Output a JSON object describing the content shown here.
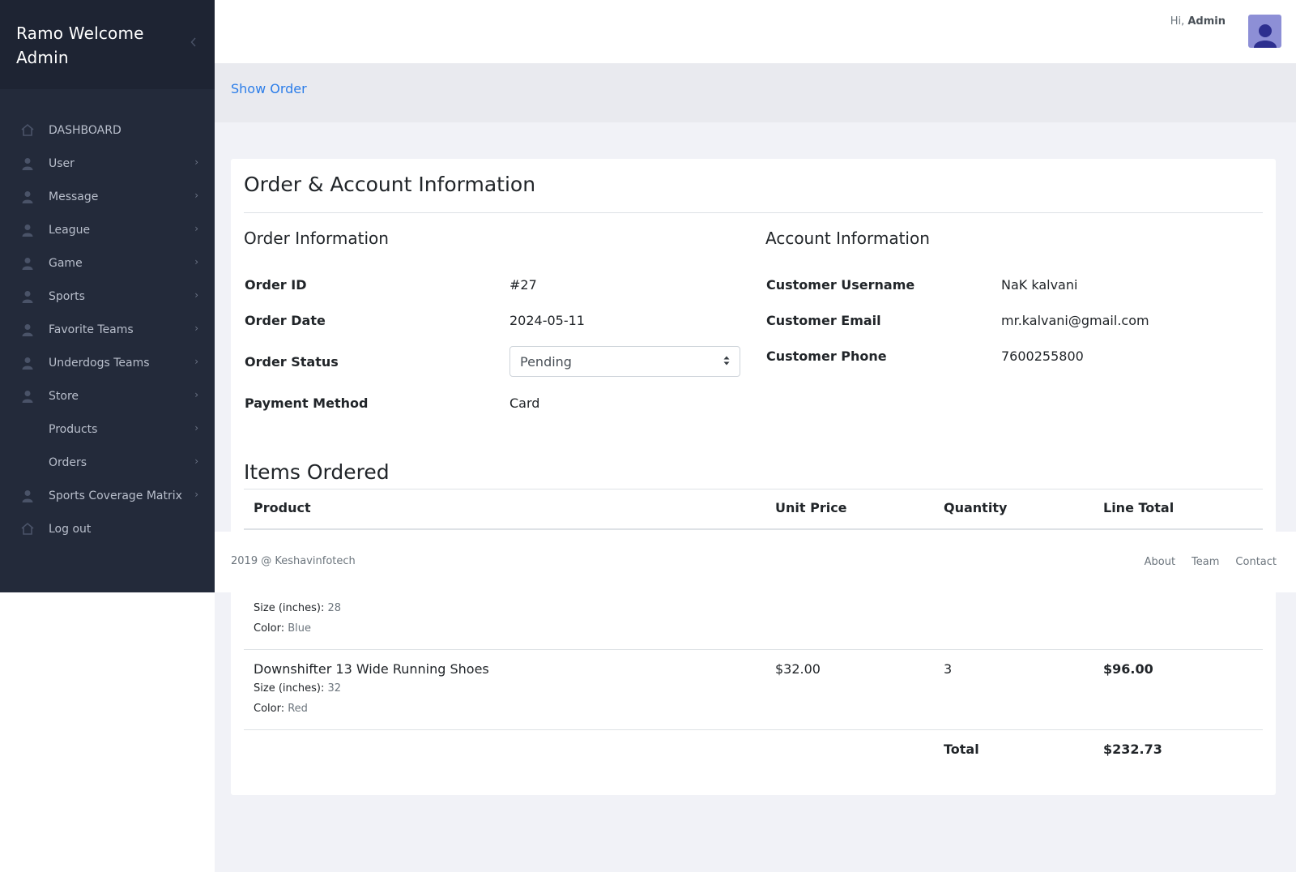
{
  "sidebar": {
    "brand": "Ramo Welcome Admin",
    "collapse_icon": "chevron-left-icon",
    "items": [
      {
        "label": "DASHBOARD",
        "icon": "home-icon"
      },
      {
        "label": "User",
        "icon": "user-icon"
      },
      {
        "label": "Message",
        "icon": "user-icon"
      },
      {
        "label": "League",
        "icon": "user-icon"
      },
      {
        "label": "Game",
        "icon": "user-icon"
      },
      {
        "label": "Sports",
        "icon": "user-icon"
      },
      {
        "label": "Favorite Teams",
        "icon": "user-icon"
      },
      {
        "label": "Underdogs Teams",
        "icon": "user-icon"
      },
      {
        "label": "Store",
        "icon": "user-icon"
      },
      {
        "label": "Products",
        "icon": ""
      },
      {
        "label": "Orders",
        "icon": ""
      },
      {
        "label": "Sports Coverage Matrix",
        "icon": "user-icon"
      },
      {
        "label": "Log out",
        "icon": "home-icon"
      }
    ]
  },
  "header": {
    "greeting": "Hi,",
    "username": "Admin"
  },
  "breadcrumb": {
    "current": "Show Order"
  },
  "card": {
    "title": "Order & Account Information",
    "order_info": {
      "title": "Order Information",
      "order_id_label": "Order ID",
      "order_id": "#27",
      "order_date_label": "Order Date",
      "order_date": "2024-05-11",
      "order_status_label": "Order Status",
      "order_status": "Pending",
      "payment_method_label": "Payment Method",
      "payment_method": "Card"
    },
    "account_info": {
      "title": "Account Information",
      "username_label": "Customer Username",
      "username": "NaK kalvani",
      "email_label": "Customer Email",
      "email": "mr.kalvani@gmail.com",
      "phone_label": "Customer Phone",
      "phone": "7600255800"
    },
    "items": {
      "title": "Items Ordered",
      "columns": [
        "Product",
        "Unit Price",
        "Quantity",
        "Line Total"
      ],
      "rows": [
        {
          "size_label": "Size (inches):",
          "size": "28",
          "color_label": "Color:",
          "color": "Blue"
        },
        {
          "product": "Downshifter 13 Wide Running Shoes",
          "size_label": "Size (inches):",
          "size": "32",
          "color_label": "Color:",
          "color": "Red",
          "unit_price": "$32.00",
          "quantity": "3",
          "line_total": "$96.00"
        }
      ],
      "total_label": "Total",
      "total": "$232.73"
    }
  },
  "footer": {
    "copyright": "2019 @ Keshavinfotech",
    "links": [
      "About",
      "Team",
      "Contact"
    ]
  },
  "colors": {
    "sidebar_bg": "#232a3a",
    "brand_bg": "#1e2433",
    "link": "#2b7de9",
    "avatar": "#8d8fd6"
  }
}
